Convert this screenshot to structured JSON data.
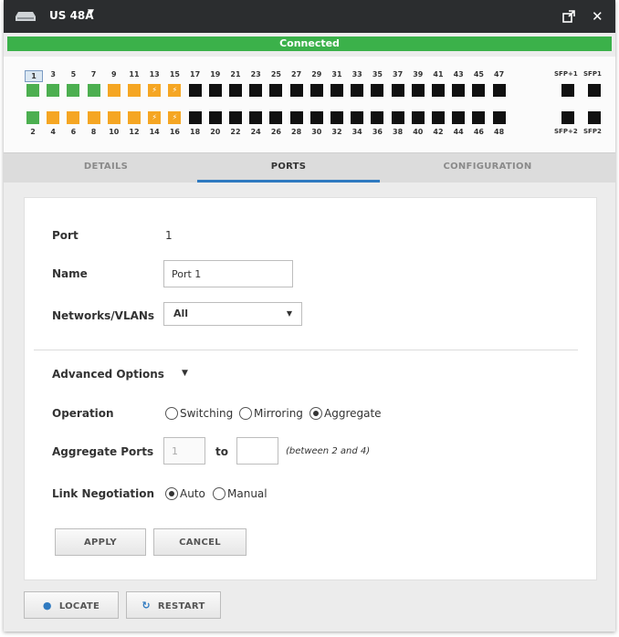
{
  "window": {
    "title": "US 48A",
    "status": "Connected",
    "icons": {
      "device": "switch-device-icon",
      "popout": "popout-icon",
      "close": "close-icon"
    }
  },
  "ports": {
    "top_labels": [
      "1",
      "3",
      "5",
      "7",
      "9",
      "11",
      "13",
      "15",
      "17",
      "19",
      "21",
      "23",
      "25",
      "27",
      "29",
      "31",
      "33",
      "35",
      "37",
      "39",
      "41",
      "43",
      "45",
      "47"
    ],
    "bottom_labels": [
      "2",
      "4",
      "6",
      "8",
      "10",
      "12",
      "14",
      "16",
      "18",
      "20",
      "22",
      "24",
      "26",
      "28",
      "30",
      "32",
      "34",
      "36",
      "38",
      "40",
      "42",
      "44",
      "46",
      "48"
    ],
    "top_states": [
      "green",
      "green",
      "green",
      "green",
      "orange",
      "orange",
      "orange-poe",
      "orange-poe",
      "off",
      "off",
      "off",
      "off",
      "off",
      "off",
      "off",
      "off",
      "off",
      "off",
      "off",
      "off",
      "off",
      "off",
      "off",
      "off"
    ],
    "bottom_states": [
      "green",
      "orange",
      "orange",
      "orange",
      "orange",
      "orange",
      "orange-poe",
      "orange-poe",
      "off",
      "off",
      "off",
      "off",
      "off",
      "off",
      "off",
      "off",
      "off",
      "off",
      "off",
      "off",
      "off",
      "off",
      "off",
      "off"
    ],
    "sfp_top": [
      "SFP+1",
      "SFP1"
    ],
    "sfp_bottom": [
      "SFP+2",
      "SFP2"
    ],
    "selected": "1",
    "colors": {
      "green": "#4caf50",
      "orange": "#f5a623",
      "off": "#111111"
    }
  },
  "tabs": [
    {
      "label": "DETAILS",
      "active": false
    },
    {
      "label": "PORTS",
      "active": true
    },
    {
      "label": "CONFIGURATION",
      "active": false
    }
  ],
  "form": {
    "port_label": "Port",
    "port_value": "1",
    "name_label": "Name",
    "name_value": "Port 1",
    "networks_label": "Networks/VLANs",
    "networks_value": "All",
    "advanced_label": "Advanced Options",
    "operation_label": "Operation",
    "operation_options": [
      "Switching",
      "Mirroring",
      "Aggregate"
    ],
    "operation_selected": "Aggregate",
    "aggregate_label": "Aggregate Ports",
    "aggregate_from": "1",
    "aggregate_to_label": "to",
    "aggregate_to": "",
    "aggregate_hint": "(between 2 and 4)",
    "link_label": "Link Negotiation",
    "link_options": [
      "Auto",
      "Manual"
    ],
    "link_selected": "Auto",
    "apply_label": "APPLY",
    "cancel_label": "CANCEL"
  },
  "footer": {
    "locate_label": "LOCATE",
    "restart_label": "RESTART"
  }
}
